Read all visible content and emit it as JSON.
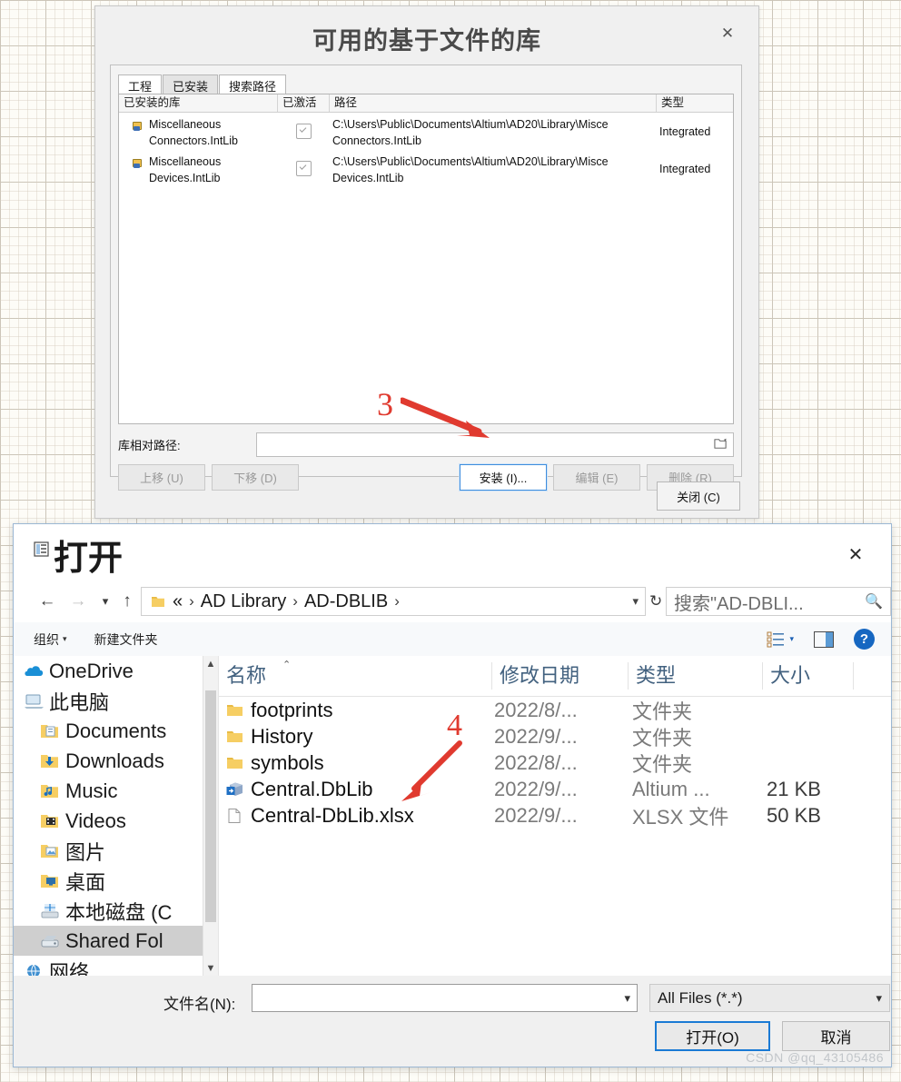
{
  "background": {
    "style": "altium-schematic-grid",
    "color": "#fdfcf7"
  },
  "lib_dialog": {
    "title": "可用的基于文件的库",
    "close_icon": "close-icon",
    "tabs": [
      {
        "label": "工程",
        "selected": false
      },
      {
        "label": "已安装",
        "selected": true
      },
      {
        "label": "搜索路径",
        "selected": false
      }
    ],
    "table": {
      "columns": [
        "已安装的库",
        "已激活",
        "路径",
        "类型"
      ],
      "rows": [
        {
          "name": "Miscellaneous Connectors.IntLib",
          "activated": true,
          "path": "C:\\Users\\Public\\Documents\\Altium\\AD20\\Library\\Misce Connectors.IntLib",
          "type": "Integrated"
        },
        {
          "name": "Miscellaneous Devices.IntLib",
          "activated": true,
          "path": "C:\\Users\\Public\\Documents\\Altium\\AD20\\Library\\Misce Devices.IntLib",
          "type": "Integrated"
        }
      ]
    },
    "relative_path": {
      "label": "库相对路径:",
      "value": "",
      "browse_icon": "folder-browse-icon"
    },
    "buttons": [
      {
        "label": "上移 (U)",
        "enabled": false
      },
      {
        "label": "下移 (D)",
        "enabled": false
      },
      {
        "label": "安装 (I)...",
        "enabled": true,
        "focused": true
      },
      {
        "label": "编辑 (E)",
        "enabled": false
      },
      {
        "label": "删除 (R)",
        "enabled": false
      }
    ],
    "close_button": "关闭 (C)",
    "annotation": "3"
  },
  "open_dialog": {
    "title": "打开",
    "title_icon": "window-icon",
    "close_icon": "close-icon",
    "nav": {
      "back_icon": "arrow-left-icon",
      "forward_icon": "arrow-right-icon",
      "recent_icon": "chevron-down-icon",
      "up_icon": "arrow-up-icon",
      "folder_icon": "folder-icon",
      "breadcrumb": [
        "«",
        "AD Library",
        "AD-DBLIB"
      ],
      "breadcrumb_sep": "›",
      "dropdown_icon": "chevron-down-icon",
      "refresh_icon": "refresh-icon"
    },
    "search": {
      "placeholder": "搜索\"AD-DBLI...",
      "icon": "search-icon"
    },
    "toolbar": {
      "organize": "组织",
      "organize_caret": "▾",
      "new_folder": "新建文件夹",
      "view_icon": "view-list-icon",
      "view_caret": "▾",
      "preview_icon": "preview-pane-icon",
      "help_icon": "help-icon",
      "help_label": "?"
    },
    "sidebar": [
      {
        "label": "OneDrive",
        "icon": "onedrive-icon",
        "level": "root",
        "selected": false
      },
      {
        "label": "此电脑",
        "icon": "computer-icon",
        "level": "root",
        "selected": false
      },
      {
        "label": "Documents",
        "icon": "folder-documents-icon",
        "level": "child",
        "selected": false
      },
      {
        "label": "Downloads",
        "icon": "folder-downloads-icon",
        "level": "child",
        "selected": false
      },
      {
        "label": "Music",
        "icon": "folder-music-icon",
        "level": "child",
        "selected": false
      },
      {
        "label": "Videos",
        "icon": "folder-videos-icon",
        "level": "child",
        "selected": false
      },
      {
        "label": "图片",
        "icon": "folder-pictures-icon",
        "level": "child",
        "selected": false
      },
      {
        "label": "桌面",
        "icon": "folder-desktop-icon",
        "level": "child",
        "selected": false
      },
      {
        "label": "本地磁盘 (C",
        "icon": "local-disk-icon",
        "level": "child",
        "selected": false
      },
      {
        "label": "Shared Fol",
        "icon": "network-drive-icon",
        "level": "child",
        "selected": true
      },
      {
        "label": "网络",
        "icon": "network-icon",
        "level": "root",
        "selected": false
      }
    ],
    "file_list": {
      "columns": [
        "名称",
        "修改日期",
        "类型",
        "大小"
      ],
      "sort_caret": "⌃",
      "rows": [
        {
          "name": "footprints",
          "icon": "folder-icon",
          "date": "2022/8/...",
          "type": "文件夹",
          "size": ""
        },
        {
          "name": "History",
          "icon": "folder-icon",
          "date": "2022/9/...",
          "type": "文件夹",
          "size": ""
        },
        {
          "name": "symbols",
          "icon": "folder-icon",
          "date": "2022/8/...",
          "type": "文件夹",
          "size": ""
        },
        {
          "name": "Central.DbLib",
          "icon": "altium-dblib-icon",
          "date": "2022/9/...",
          "type": "Altium ...",
          "size": "21 KB"
        },
        {
          "name": "Central-DbLib.xlsx",
          "icon": "document-icon",
          "date": "2022/9/...",
          "type": "XLSX 文件",
          "size": "50 KB"
        }
      ]
    },
    "annotation": "4",
    "bottom": {
      "filename_label": "文件名(N):",
      "filename_value": "",
      "filter_value": "All Files (*.*)",
      "open_button": "打开(O)",
      "cancel_button": "取消"
    }
  },
  "watermark": "CSDN @qq_43105486"
}
